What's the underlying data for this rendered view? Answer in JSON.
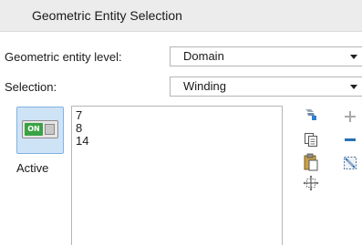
{
  "header": {
    "title": "Geometric Entity Selection"
  },
  "entity_level": {
    "label": "Geometric entity level:",
    "value": "Domain"
  },
  "selection": {
    "label": "Selection:",
    "value": "Winding"
  },
  "active": {
    "toggle_text": "ON",
    "label": "Active"
  },
  "selection_list": {
    "items": [
      "7",
      "8",
      "14"
    ]
  },
  "toolbar": {
    "icons": [
      "paste-from-graphics-icon",
      "copy-icon",
      "paste-icon",
      "zoom-to-selection-icon",
      "add-icon",
      "remove-icon",
      "clear-selection-icon"
    ]
  }
}
